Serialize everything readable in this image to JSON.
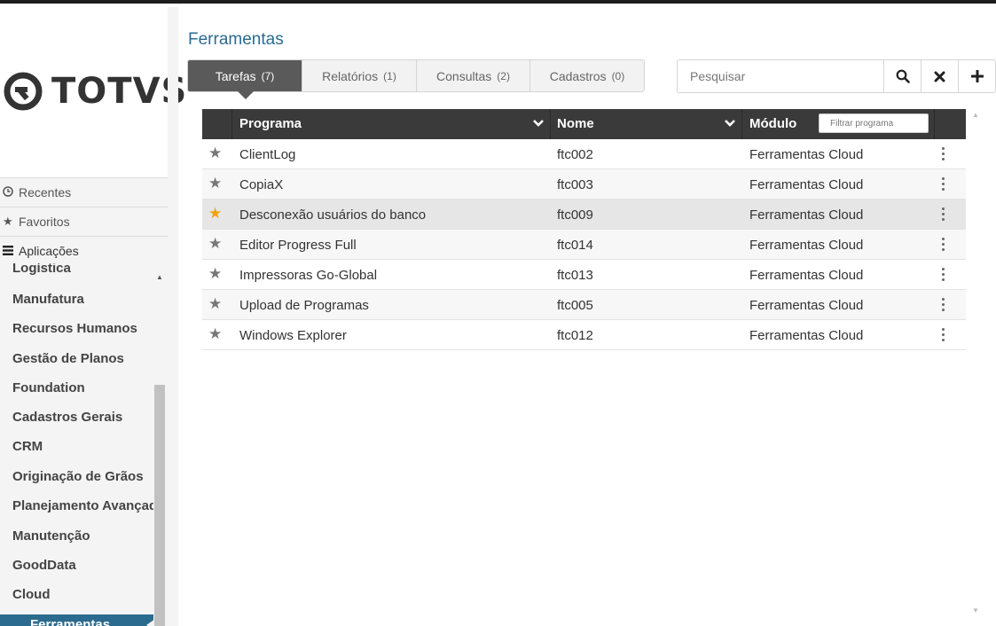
{
  "app": {
    "logo_text": "TOTVS"
  },
  "sidebar": {
    "sections": [
      {
        "label": "Recentes",
        "icon": "clock-icon"
      },
      {
        "label": "Favoritos",
        "icon": "star-icon"
      },
      {
        "label": "Aplicações",
        "icon": "list-icon"
      }
    ],
    "menu": [
      {
        "label": "Logística"
      },
      {
        "label": "Manufatura"
      },
      {
        "label": "Recursos Humanos"
      },
      {
        "label": "Gestão de Planos"
      },
      {
        "label": "Foundation"
      },
      {
        "label": "Cadastros Gerais"
      },
      {
        "label": "CRM"
      },
      {
        "label": "Originação de Grãos"
      },
      {
        "label": "Planejamento Avançado"
      },
      {
        "label": "Manutenção"
      },
      {
        "label": "GoodData"
      },
      {
        "label": "Cloud"
      },
      {
        "label": "Ferramentas",
        "active": true
      }
    ]
  },
  "main": {
    "title": "Ferramentas",
    "tabs": [
      {
        "label": "Tarefas",
        "count": "(7)",
        "active": true
      },
      {
        "label": "Relatórios",
        "count": "(1)"
      },
      {
        "label": "Consultas",
        "count": "(2)"
      },
      {
        "label": "Cadastros",
        "count": "(0)"
      }
    ],
    "search": {
      "placeholder": "Pesquisar"
    },
    "grid": {
      "columns": {
        "programa": "Programa",
        "nome": "Nome",
        "modulo": "Módulo"
      },
      "filter_placeholder": "Filtrar programa",
      "rows": [
        {
          "programa": "ClientLog",
          "nome": "ftc002",
          "modulo": "Ferramentas Cloud",
          "favorite": false
        },
        {
          "programa": "CopiaX",
          "nome": "ftc003",
          "modulo": "Ferramentas Cloud",
          "favorite": false
        },
        {
          "programa": "Desconexão usuários do banco",
          "nome": "ftc009",
          "modulo": "Ferramentas Cloud",
          "favorite": true
        },
        {
          "programa": "Editor Progress Full",
          "nome": "ftc014",
          "modulo": "Ferramentas Cloud",
          "favorite": false
        },
        {
          "programa": "Impressoras Go-Global",
          "nome": "ftc013",
          "modulo": "Ferramentas Cloud",
          "favorite": false
        },
        {
          "programa": "Upload de Programas",
          "nome": "ftc005",
          "modulo": "Ferramentas Cloud",
          "favorite": false
        },
        {
          "programa": "Windows Explorer",
          "nome": "ftc012",
          "modulo": "Ferramentas Cloud",
          "favorite": false
        }
      ]
    }
  },
  "colors": {
    "accent": "#2b6b8f",
    "favorite": "#f0a30a",
    "header_dark": "#3a3a3a"
  }
}
